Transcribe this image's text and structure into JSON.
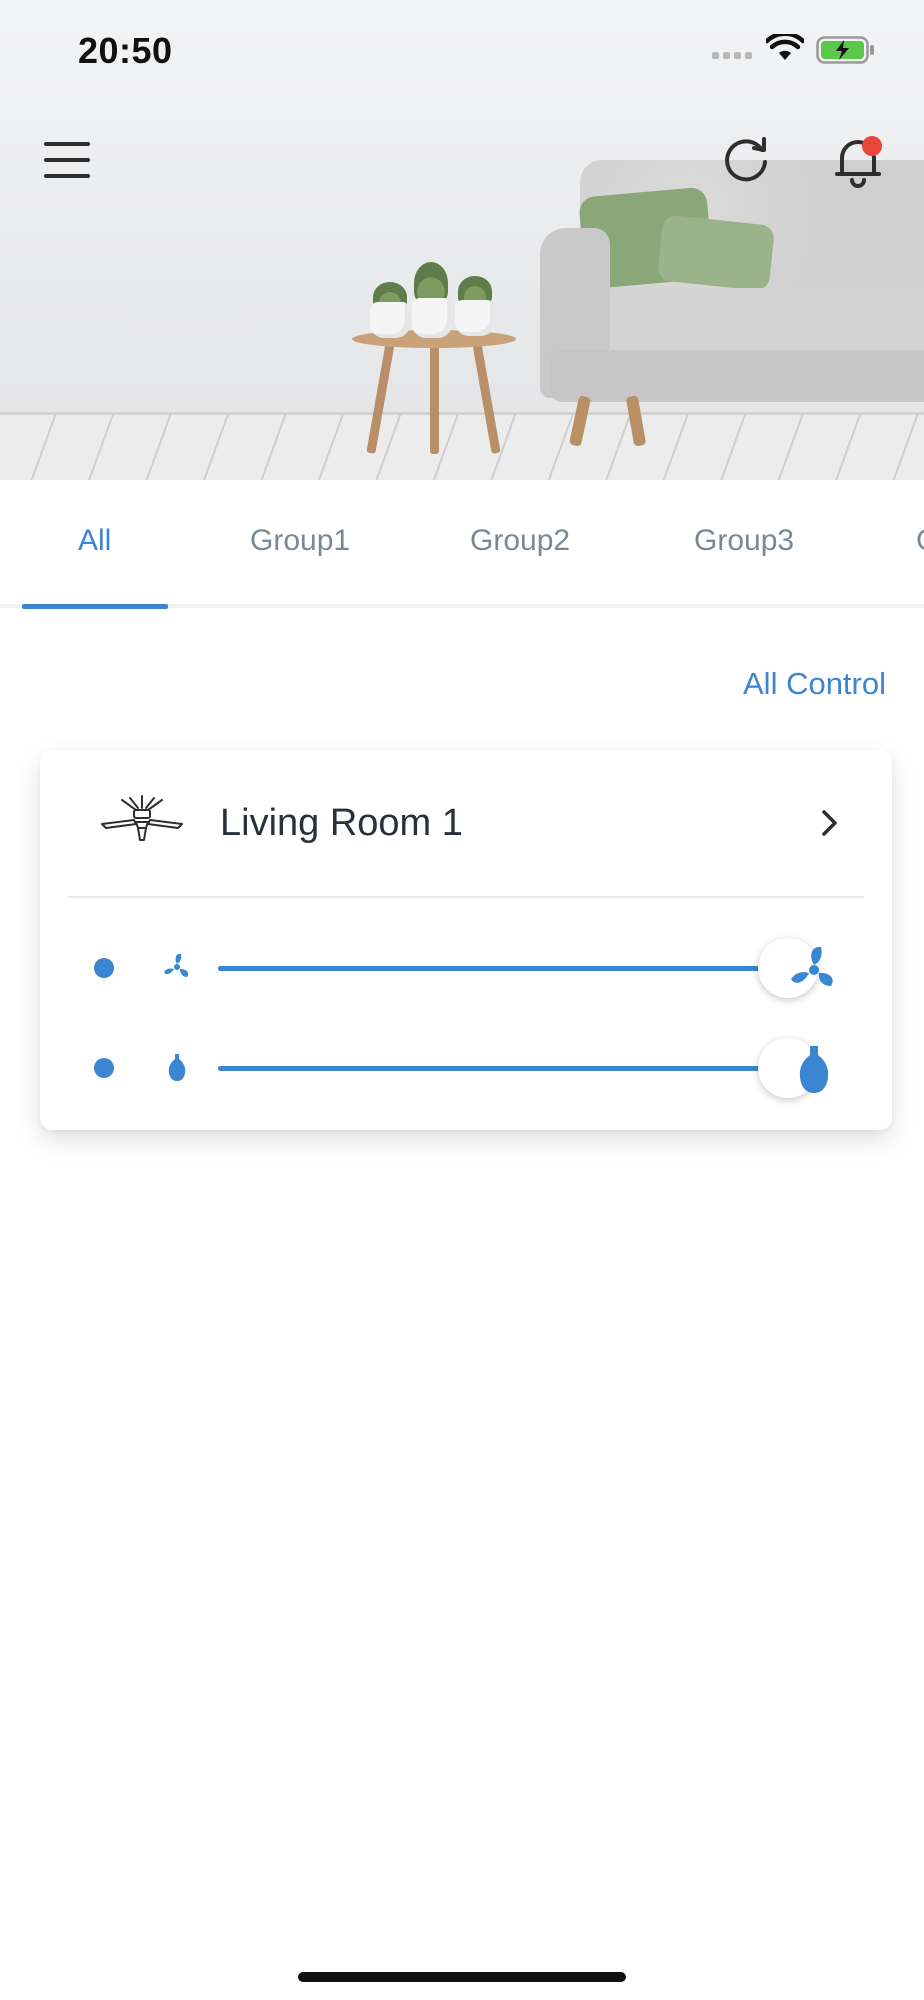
{
  "status_bar": {
    "time": "20:50"
  },
  "tabs": [
    {
      "label": "All",
      "active": true
    },
    {
      "label": "Group1",
      "active": false
    },
    {
      "label": "Group2",
      "active": false
    },
    {
      "label": "Group3",
      "active": false
    },
    {
      "label": "G",
      "active": false
    }
  ],
  "all_control_label": "All Control",
  "device_card": {
    "room_name": "Living Room 1",
    "fan_speed": {
      "value": 1.0
    },
    "light_level": {
      "value": 1.0
    }
  },
  "colors": {
    "accent": "#3a86d0",
    "notification": "#e8463a",
    "battery": "#5cc84a"
  },
  "icons": [
    "menu-icon",
    "refresh-icon",
    "bell-icon",
    "ceiling-fan-icon",
    "chevron-right-icon",
    "fan-small-icon",
    "fan-large-icon",
    "bulb-small-icon",
    "bulb-large-icon",
    "wifi-icon",
    "battery-charging-icon",
    "signal-icon"
  ]
}
